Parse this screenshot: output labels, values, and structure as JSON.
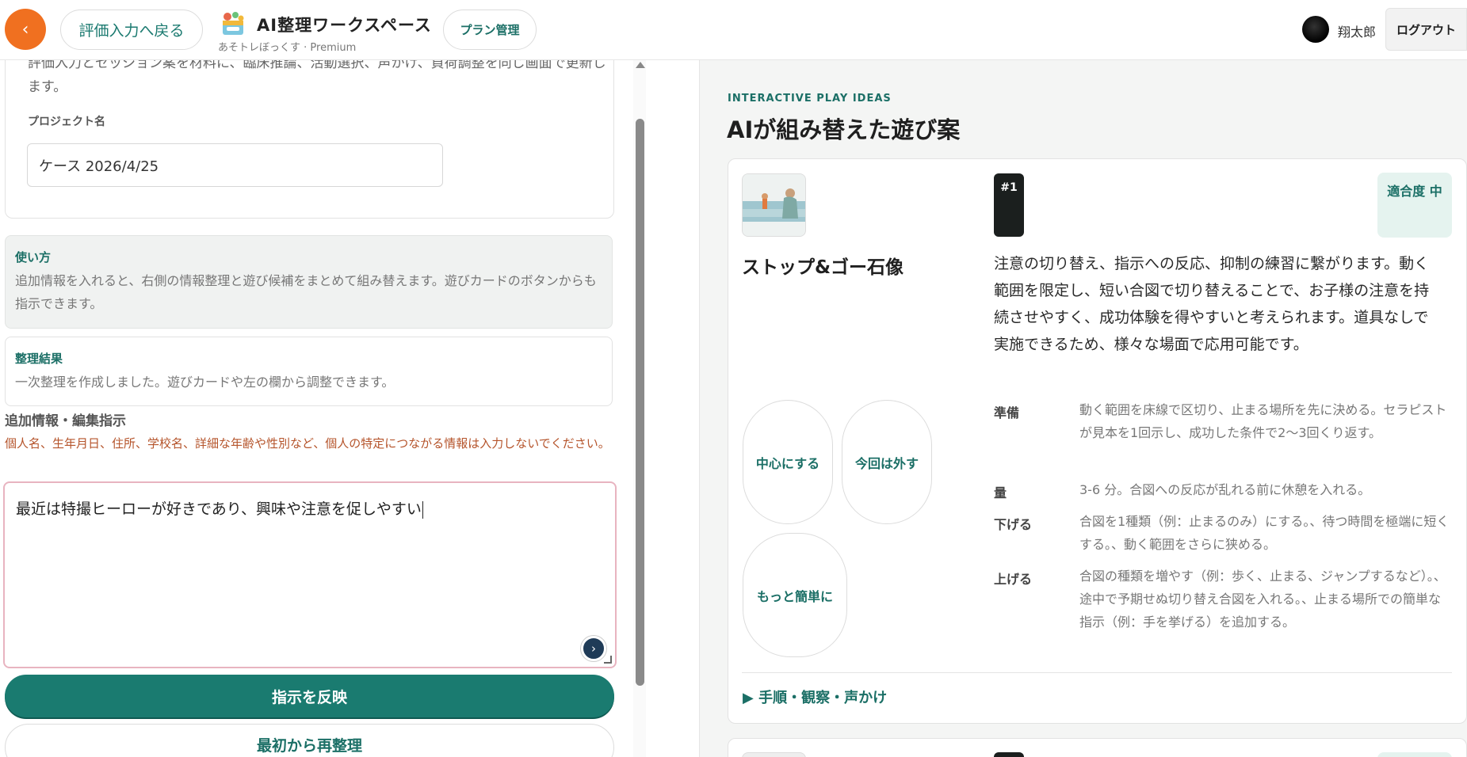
{
  "header": {
    "back_icon": "‹",
    "back_label": "評価入力へ戻る",
    "app_title": "AI整理ワークスペース",
    "app_subtitle": "あそトレぼっくす · Premium",
    "plan_label": "プラン管理",
    "user_name": "翔太郎",
    "logout_label": "ログアウト",
    "accent_color": "#f07020"
  },
  "left": {
    "description": "評価入力とセッション案を材料に、臨床推論、活動選択、声かけ、負荷調整を同じ画面で更新します。",
    "project_label": "プロジェクト名",
    "project_value": "ケース 2026/4/25",
    "usage_title": "使い方",
    "usage_body": "追加情報を入れると、右側の情報整理と遊び候補をまとめて組み替えます。遊びカードのボタンからも指示できます。",
    "result_title": "整理結果",
    "result_body": "一次整理を作成しました。遊びカードや左の欄から調整できます。",
    "add_label": "追加情報・編集指示",
    "warning": "個人名、生年月日、住所、学校名、詳細な年齢や性別など、個人の特定につながる情報は入力しないでください。",
    "textarea_value": "最近は特撮ヒーローが好きであり、興味や注意を促しやすい",
    "assistant_icon": "›",
    "apply_label": "指示を反映",
    "reorganize_label": "最初から再整理",
    "primary_color": "#1a7b70"
  },
  "right": {
    "eyebrow": "INTERACTIVE PLAY IDEAS",
    "title": "AIが組み替えた遊び案",
    "card": {
      "rank": "#1",
      "fit": "適合度 中",
      "name": "ストップ&ゴー石像",
      "description": "注意の切り替え、指示への反応、抑制の練習に繋がります。動く範囲を限定し、短い合図で切り替えることで、お子様の注意を持続させやすく、成功体験を得やすいと考えられます。道具なしで実施できるため、様々な場面で応用可能です。",
      "chips": {
        "center": "中心にする",
        "omit": "今回は外す",
        "simpler": "もっと簡単に"
      },
      "details": [
        {
          "label": "準備",
          "value": "動く範囲を床線で区切り、止まる場所を先に決める。セラピストが見本を1回示し、成功した条件で2〜3回くり返す。"
        },
        {
          "label": "量",
          "value": "3-6 分。合図への反応が乱れる前に休憩を入れる。"
        },
        {
          "label": "下げる",
          "value": "合図を1種類（例：止まるのみ）にする。、待つ時間を極端に短くする。、動く範囲をさらに狭める。"
        },
        {
          "label": "上げる",
          "value": "合図の種類を増やす（例：歩く、止まる、ジャンプするなど）。、途中で予期せぬ切り替え合図を入れる。、止まる場所での簡単な指示（例：手を挙げる）を追加する。"
        }
      ],
      "steps_label": "▶ 手順・観察・声かけ"
    }
  }
}
